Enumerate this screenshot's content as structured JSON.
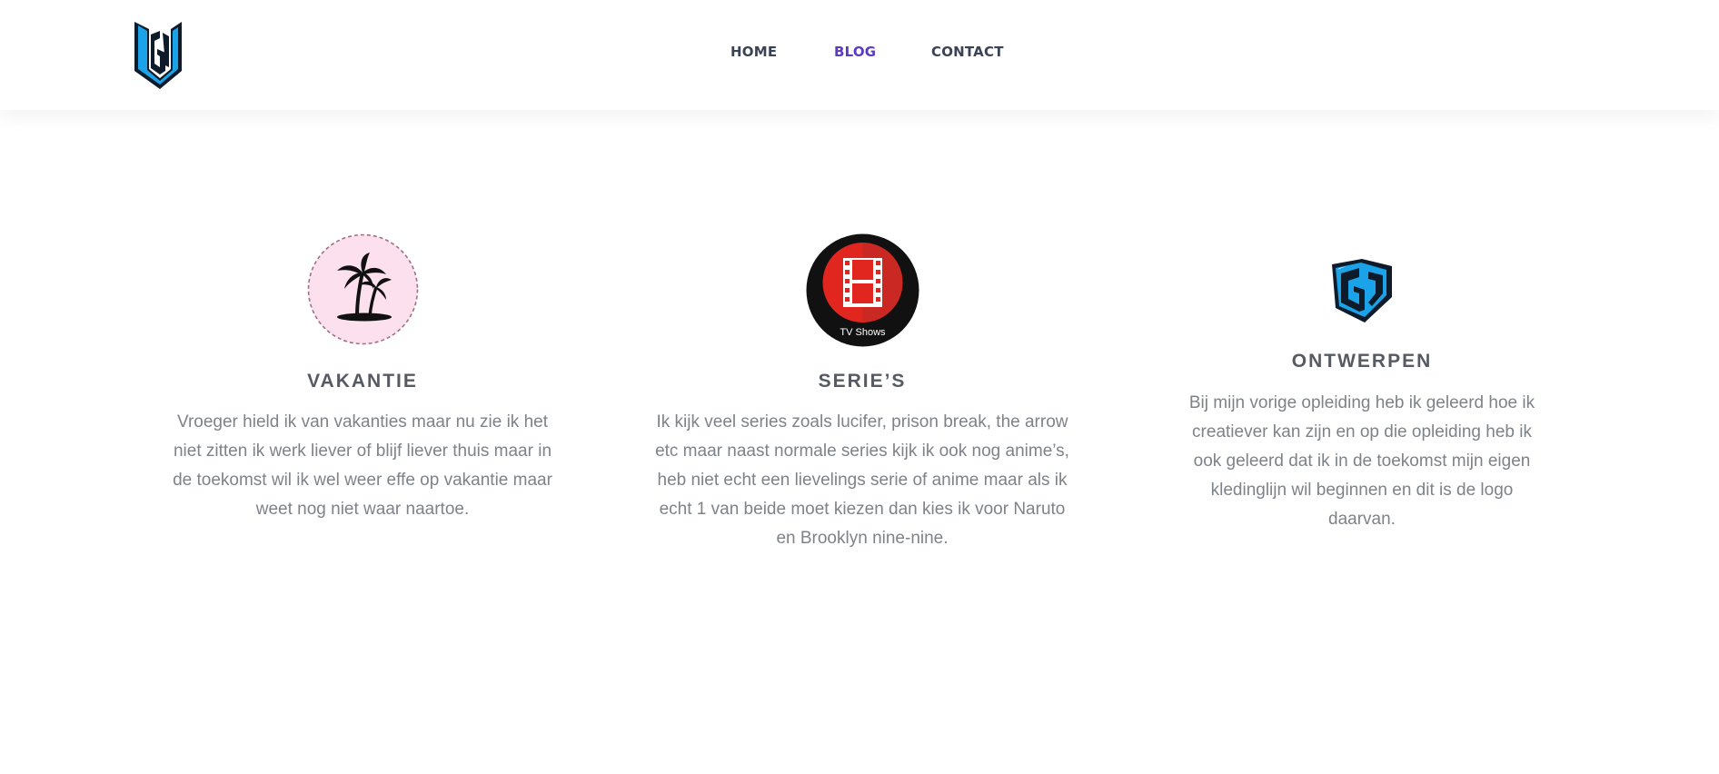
{
  "header": {
    "logo_name": "gv-logo-icon",
    "nav": [
      {
        "label": "HOME",
        "active": false
      },
      {
        "label": "BLOG",
        "active": true
      },
      {
        "label": "CONTACT",
        "active": false
      }
    ]
  },
  "cards": [
    {
      "icon": "palm-trees-icon",
      "title": "VAKANTIE",
      "description": "Vroeger hield ik van vakanties maar nu zie ik het niet zitten ik werk liever of blijf liever thuis maar in de toekomst wil ik wel weer effe op vakantie maar weet nog niet waar naartoe."
    },
    {
      "icon": "tv-shows-icon",
      "icon_caption": "TV Shows",
      "title": "SERIE’S",
      "description": "Ik kijk veel series zoals lucifer, prison break, the arrow etc maar naast normale series kijk ik ook nog anime’s, heb niet echt een lievelings serie of anime maar als ik echt 1 van beide moet kiezen dan kies ik voor Naruto en Brooklyn nine-nine."
    },
    {
      "icon": "gv-logo-icon",
      "title": "ONTWERPEN",
      "description": "Bij mijn vorige opleiding heb ik geleerd hoe ik creatiever kan zijn en op die opleiding heb ik ook geleerd dat ik in de toekomst mijn eigen kledinglijn wil beginnen en dit is de logo daarvan."
    }
  ],
  "colors": {
    "nav_text": "#3a4256",
    "nav_active": "#5b3bc4",
    "title": "#565a63",
    "body_text": "#7e8389",
    "logo_blue": "#1aa3e8",
    "tv_red": "#e0261f",
    "palm_bg": "#fde0ee"
  }
}
